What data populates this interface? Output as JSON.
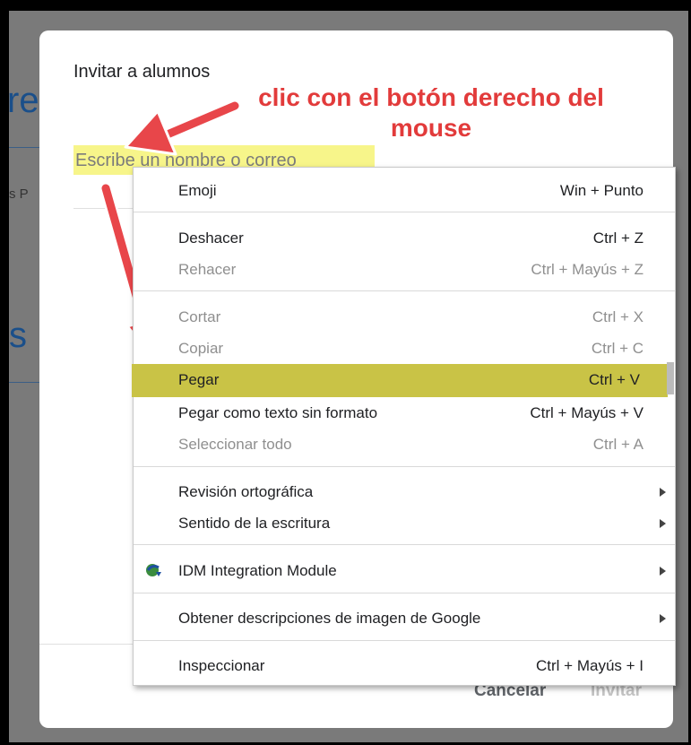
{
  "background": {
    "fragments": [
      "re",
      "s P",
      "s"
    ]
  },
  "dialog": {
    "title": "Invitar a alumnos",
    "input_placeholder": "Escribe un nombre o correo",
    "cancel_label": "Cancelar",
    "invite_label": "Invitar"
  },
  "annotation": {
    "line1": "clic con el botón derecho del",
    "line2": "mouse"
  },
  "context_menu": {
    "items": [
      {
        "label": "Emoji",
        "shortcut": "Win + Punto"
      },
      {
        "label": "Deshacer",
        "shortcut": "Ctrl + Z"
      },
      {
        "label": "Rehacer",
        "shortcut": "Ctrl + Mayús + Z",
        "disabled": true
      },
      {
        "label": "Cortar",
        "shortcut": "Ctrl + X",
        "disabled": true
      },
      {
        "label": "Copiar",
        "shortcut": "Ctrl + C",
        "disabled": true
      },
      {
        "label": "Pegar",
        "shortcut": "Ctrl + V",
        "highlighted": true
      },
      {
        "label": "Pegar como texto sin formato",
        "shortcut": "Ctrl + Mayús + V"
      },
      {
        "label": "Seleccionar todo",
        "shortcut": "Ctrl + A",
        "disabled": true
      },
      {
        "label": "Revisión ortográfica",
        "submenu": true
      },
      {
        "label": "Sentido de la escritura",
        "submenu": true
      },
      {
        "label": "IDM Integration Module",
        "submenu": true,
        "icon": "idm-icon"
      },
      {
        "label": "Obtener descripciones de imagen de Google",
        "submenu": true
      },
      {
        "label": "Inspeccionar",
        "shortcut": "Ctrl + Mayús + I"
      }
    ]
  },
  "colors": {
    "highlight_input": "#f7f58a",
    "highlight_menu": "#c9c346",
    "annotation": "#e23b3b"
  }
}
